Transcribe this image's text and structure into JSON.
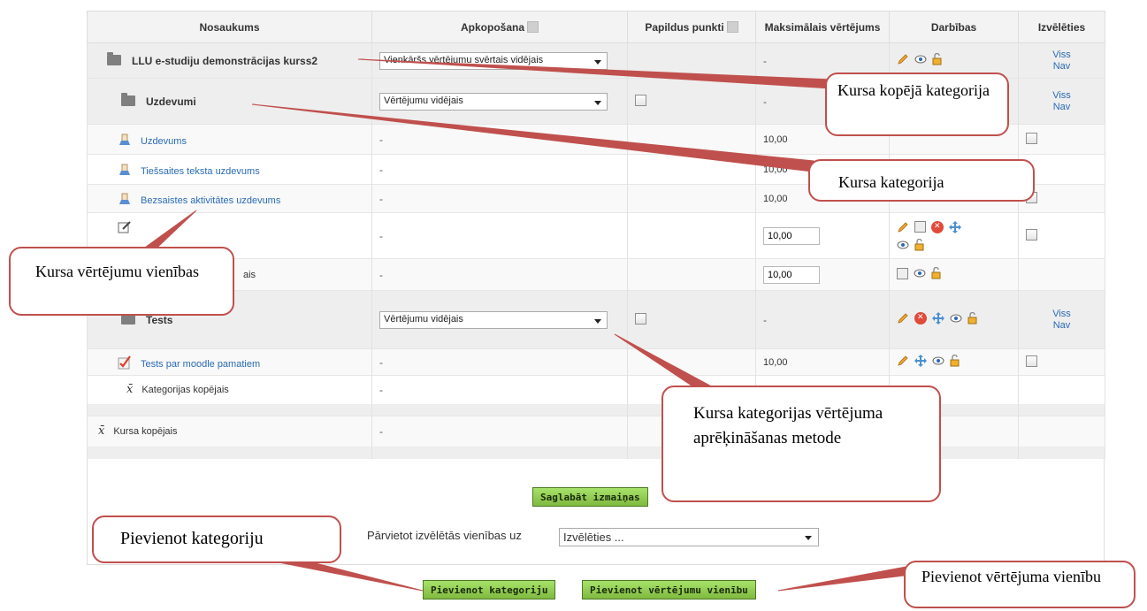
{
  "columns": {
    "name": "Nosaukums",
    "aggregation": "Apkopošana",
    "extra_points": "Papildus punkti",
    "max_grade": "Maksimālais vērtējums",
    "actions": "Darbības",
    "select": "Izvēlēties"
  },
  "rows": {
    "course": {
      "name": "LLU e-studiju demonstrācijas kurss2",
      "aggregation": "Vienkāršs vērtējumu svērtais vidējais",
      "max": "-",
      "all": "Viss",
      "none": "Nav"
    },
    "uzdevumi": {
      "name": "Uzdevumi",
      "aggregation": "Vērtējumu vidējais",
      "max": "-",
      "all": "Viss",
      "none": "Nav"
    },
    "item1": {
      "name": "Uzdevums",
      "agg": "-",
      "max": "10,00"
    },
    "item2": {
      "name": "Tiešsaites teksta uzdevums",
      "agg": "-",
      "max": "10,00"
    },
    "item3": {
      "name": "Bezsaistes aktivitātes uzdevums",
      "agg": "-",
      "max": "10,00"
    },
    "item4": {
      "agg": "-",
      "max": "10,00"
    },
    "item5": {
      "name_tail": "ais",
      "agg": "-",
      "max": "10,00"
    },
    "tests": {
      "name": "Tests",
      "aggregation": "Vērtējumu vidējais",
      "max": "-",
      "all": "Viss",
      "none": "Nav"
    },
    "quiz": {
      "name": "Tests par moodle pamatiem",
      "agg": "-",
      "max": "10,00"
    },
    "cat_total": {
      "name": "Kategorijas kopējais",
      "agg": "-"
    },
    "course_total": {
      "name": "Kursa kopējais",
      "agg": "-"
    }
  },
  "buttons": {
    "save": "Saglabāt izmaiņas",
    "add_category": "Pievienot kategoriju",
    "add_item": "Pievienot vērtējumu vienību"
  },
  "move": {
    "label": "Pārvietot izvēlētās vienības uz",
    "selected": "Izvēlēties ..."
  },
  "callouts": {
    "course_total_cat": "Kursa kopējā kategorija",
    "course_cat": "Kursa kategorija",
    "grade_items": "Kursa vērtējumu vienības",
    "calc_method": "Kursa kategorijas vērtējuma aprēķināšanas metode",
    "add_category": "Pievienot kategoriju",
    "add_grade_item": "Pievienot vērtējuma vienību"
  },
  "colors": {
    "accent_button": "#8bc34a",
    "callout_border": "#c0504d",
    "link": "#2a6ab5"
  }
}
